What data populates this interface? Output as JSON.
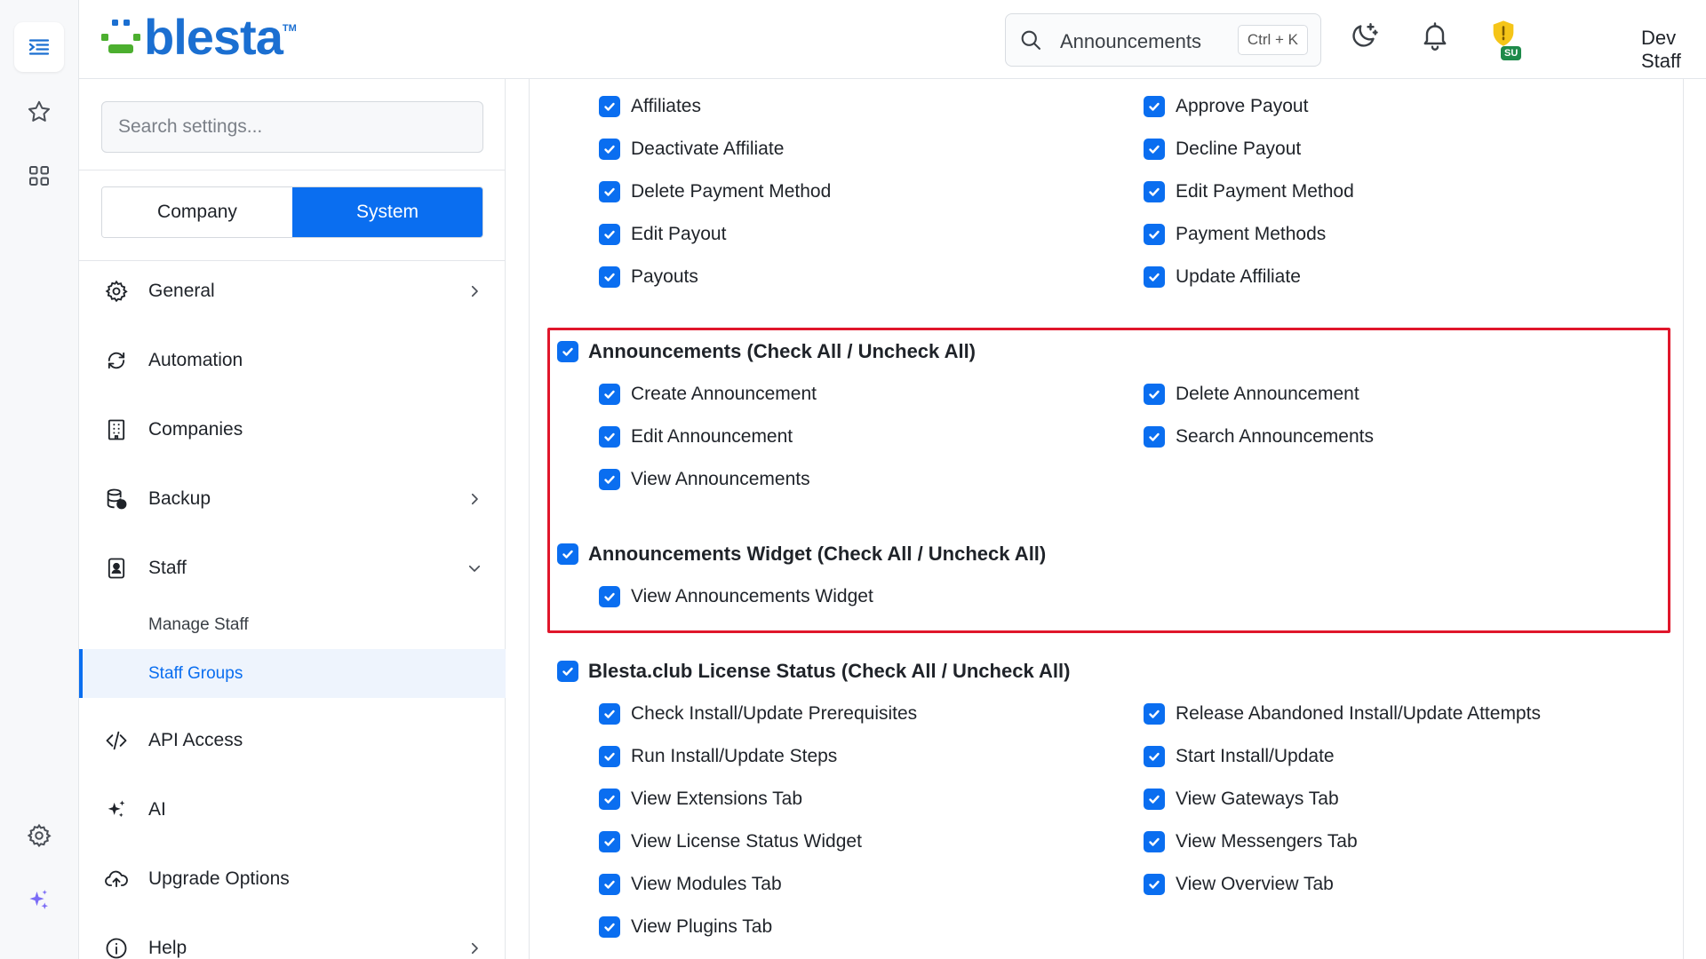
{
  "app": {
    "brand": "blesta",
    "brand_tm": "TM"
  },
  "rail": {
    "items": [
      {
        "icon": "menu-toggle-icon"
      },
      {
        "icon": "star-icon"
      },
      {
        "icon": "grid-icon"
      },
      {
        "icon": "gear-icon"
      },
      {
        "icon": "sparkle-icon"
      }
    ]
  },
  "header": {
    "search_text": "Announcements",
    "search_shortcut": "Ctrl + K",
    "badge": "SU",
    "user_name": "Dev Staff"
  },
  "sidebar": {
    "search_placeholder": "Search settings...",
    "segments": {
      "company": "Company",
      "system": "System",
      "selected": "System"
    },
    "items": [
      {
        "label": "General",
        "icon": "gear-icon",
        "chevron": "right"
      },
      {
        "label": "Automation",
        "icon": "refresh-icon",
        "chevron": ""
      },
      {
        "label": "Companies",
        "icon": "building-icon",
        "chevron": ""
      },
      {
        "label": "Backup",
        "icon": "database-icon",
        "chevron": "right"
      },
      {
        "label": "Staff",
        "icon": "id-badge-icon",
        "chevron": "down"
      },
      {
        "label": "API Access",
        "icon": "code-icon",
        "chevron": ""
      },
      {
        "label": "AI",
        "icon": "sparkle-icon",
        "chevron": ""
      },
      {
        "label": "Upgrade Options",
        "icon": "cloud-upload-icon",
        "chevron": ""
      },
      {
        "label": "Help",
        "icon": "info-icon",
        "chevron": "right"
      }
    ],
    "staff_sub": [
      {
        "label": "Manage Staff",
        "active": false
      },
      {
        "label": "Staff Groups",
        "active": true
      }
    ]
  },
  "main": {
    "affiliates_perms": {
      "left": [
        "Affiliates",
        "Deactivate Affiliate",
        "Delete Payment Method",
        "Edit Payout",
        "Payouts"
      ],
      "right": [
        "Approve Payout",
        "Decline Payout",
        "Edit Payment Method",
        "Payment Methods",
        "Update Affiliate"
      ]
    },
    "groups": [
      {
        "title": "Announcements (Check All / Uncheck All)",
        "left": [
          "Create Announcement",
          "Edit Announcement",
          "View Announcements"
        ],
        "right": [
          "Delete Announcement",
          "Search Announcements"
        ]
      },
      {
        "title": "Announcements Widget (Check All / Uncheck All)",
        "left": [
          "View Announcements Widget"
        ],
        "right": []
      },
      {
        "title": "Blesta.club License Status (Check All / Uncheck All)",
        "left": [
          "Check Install/Update Prerequisites",
          "Run Install/Update Steps",
          "View Extensions Tab",
          "View License Status Widget",
          "View Modules Tab",
          "View Plugins Tab"
        ],
        "right": [
          "Release Abandoned Install/Update Attempts",
          "Start Install/Update",
          "View Gateways Tab",
          "View Messengers Tab",
          "View Overview Tab"
        ]
      }
    ],
    "highlighted_groups": [
      "Announcements (Check All / Uncheck All)",
      "Announcements Widget (Check All / Uncheck All)"
    ],
    "all_checked": true
  },
  "colors": {
    "accent": "#0a6ef0",
    "highlight": "#e0162b",
    "badge_shield": "#f5c518",
    "badge_su": "#1e8a4a"
  }
}
